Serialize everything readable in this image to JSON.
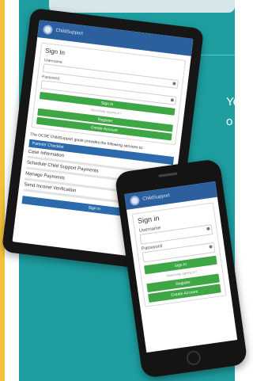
{
  "side_text": [
    "Yo",
    "o"
  ],
  "tablet": {
    "logo": "ChildSupport",
    "title": "Sign In",
    "username_label": "Username",
    "password_label": "Password",
    "sign_in_button": "Sign In",
    "help_link": "Need help signing in?",
    "register_button": "Register",
    "create_account_button": "Create Account",
    "intro": "The OCSE ChildSupport guide provides the following services to:",
    "section_header": "Parents' Checklist",
    "items": [
      "Case Information",
      "Schedule Child Support Payments",
      "Manage Payments",
      "Send Income Verification"
    ],
    "footer": "Sign In"
  },
  "phone": {
    "logo": "ChildSupport",
    "title": "Sign in",
    "username_label": "Username",
    "password_label": "Password",
    "sign_in_button": "Sign In",
    "help_link": "Need help signing in?",
    "register_button": "Register",
    "create_account_button": "Create Account"
  }
}
